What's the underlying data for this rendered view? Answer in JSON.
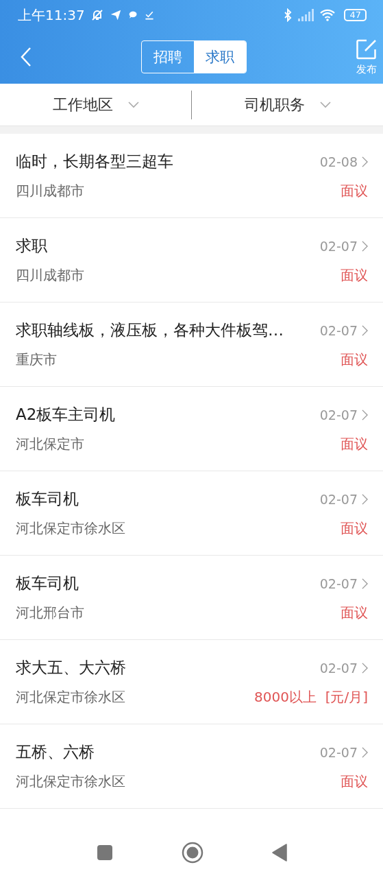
{
  "status_bar": {
    "time": "上午11:37",
    "battery": "47"
  },
  "header": {
    "tabs": [
      {
        "label": "招聘",
        "selected": false
      },
      {
        "label": "求职",
        "selected": true
      }
    ],
    "publish": "发布"
  },
  "filters": [
    {
      "label": "工作地区"
    },
    {
      "label": "司机职务"
    }
  ],
  "listings": [
    {
      "title": "临时，长期各型三超车",
      "date": "02-08",
      "location": "四川成都市",
      "salary": "面议"
    },
    {
      "title": "求职",
      "date": "02-07",
      "location": "四川成都市",
      "salary": "面议"
    },
    {
      "title": "求职轴线板，液压板，各种大件板驾…",
      "date": "02-07",
      "location": "重庆市",
      "salary": "面议"
    },
    {
      "title": "A2板车主司机",
      "date": "02-07",
      "location": "河北保定市",
      "salary": "面议"
    },
    {
      "title": "板车司机",
      "date": "02-07",
      "location": "河北保定市徐水区",
      "salary": "面议"
    },
    {
      "title": "板车司机",
      "date": "02-07",
      "location": "河北邢台市",
      "salary": "面议"
    },
    {
      "title": "求大五、大六桥",
      "date": "02-07",
      "location": "河北保定市徐水区",
      "salary": "8000以上  [元/月]"
    },
    {
      "title": "五桥、六桥",
      "date": "02-07",
      "location": "河北保定市徐水区",
      "salary": "面议"
    }
  ]
}
